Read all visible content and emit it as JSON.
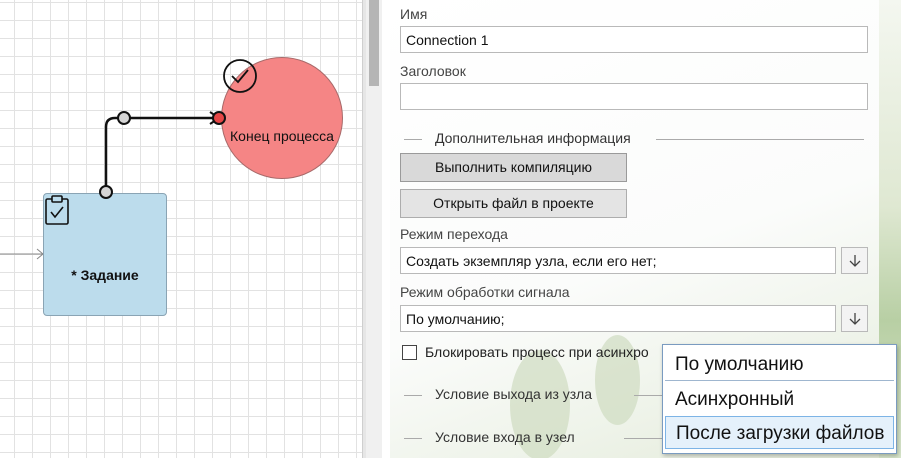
{
  "canvas": {
    "task_node": {
      "label": "* Задание"
    },
    "end_node": {
      "label": "Конец процесса"
    }
  },
  "panel": {
    "name": {
      "label": "Имя",
      "value": "Connection 1"
    },
    "title": {
      "label": "Заголовок",
      "value": ""
    },
    "additional_section": "Дополнительная информация",
    "compile_button": "Выполнить компиляцию",
    "open_file_button": "Открыть файл в проекте",
    "transition_mode": {
      "label": "Режим перехода",
      "value": "Создать экземпляр узла, если его нет;"
    },
    "signal_mode": {
      "label": "Режим обработки сигнала",
      "value": "По умолчанию;"
    },
    "block_checkbox": {
      "label": "Блокировать процесс при асинхро",
      "checked": false
    },
    "exit_condition_section": "Условие выхода из узла",
    "entry_condition_section": "Условие входа в узел"
  },
  "dropdown": {
    "options": [
      "По умолчанию",
      "Асинхронный",
      "После загрузки файлов"
    ],
    "hovered_index": 2
  },
  "colors": {
    "task_fill": "#bcdcec",
    "end_fill": "#f58585",
    "popup_border": "#7a9bc0",
    "hover_fill": "#e5f1fb"
  }
}
